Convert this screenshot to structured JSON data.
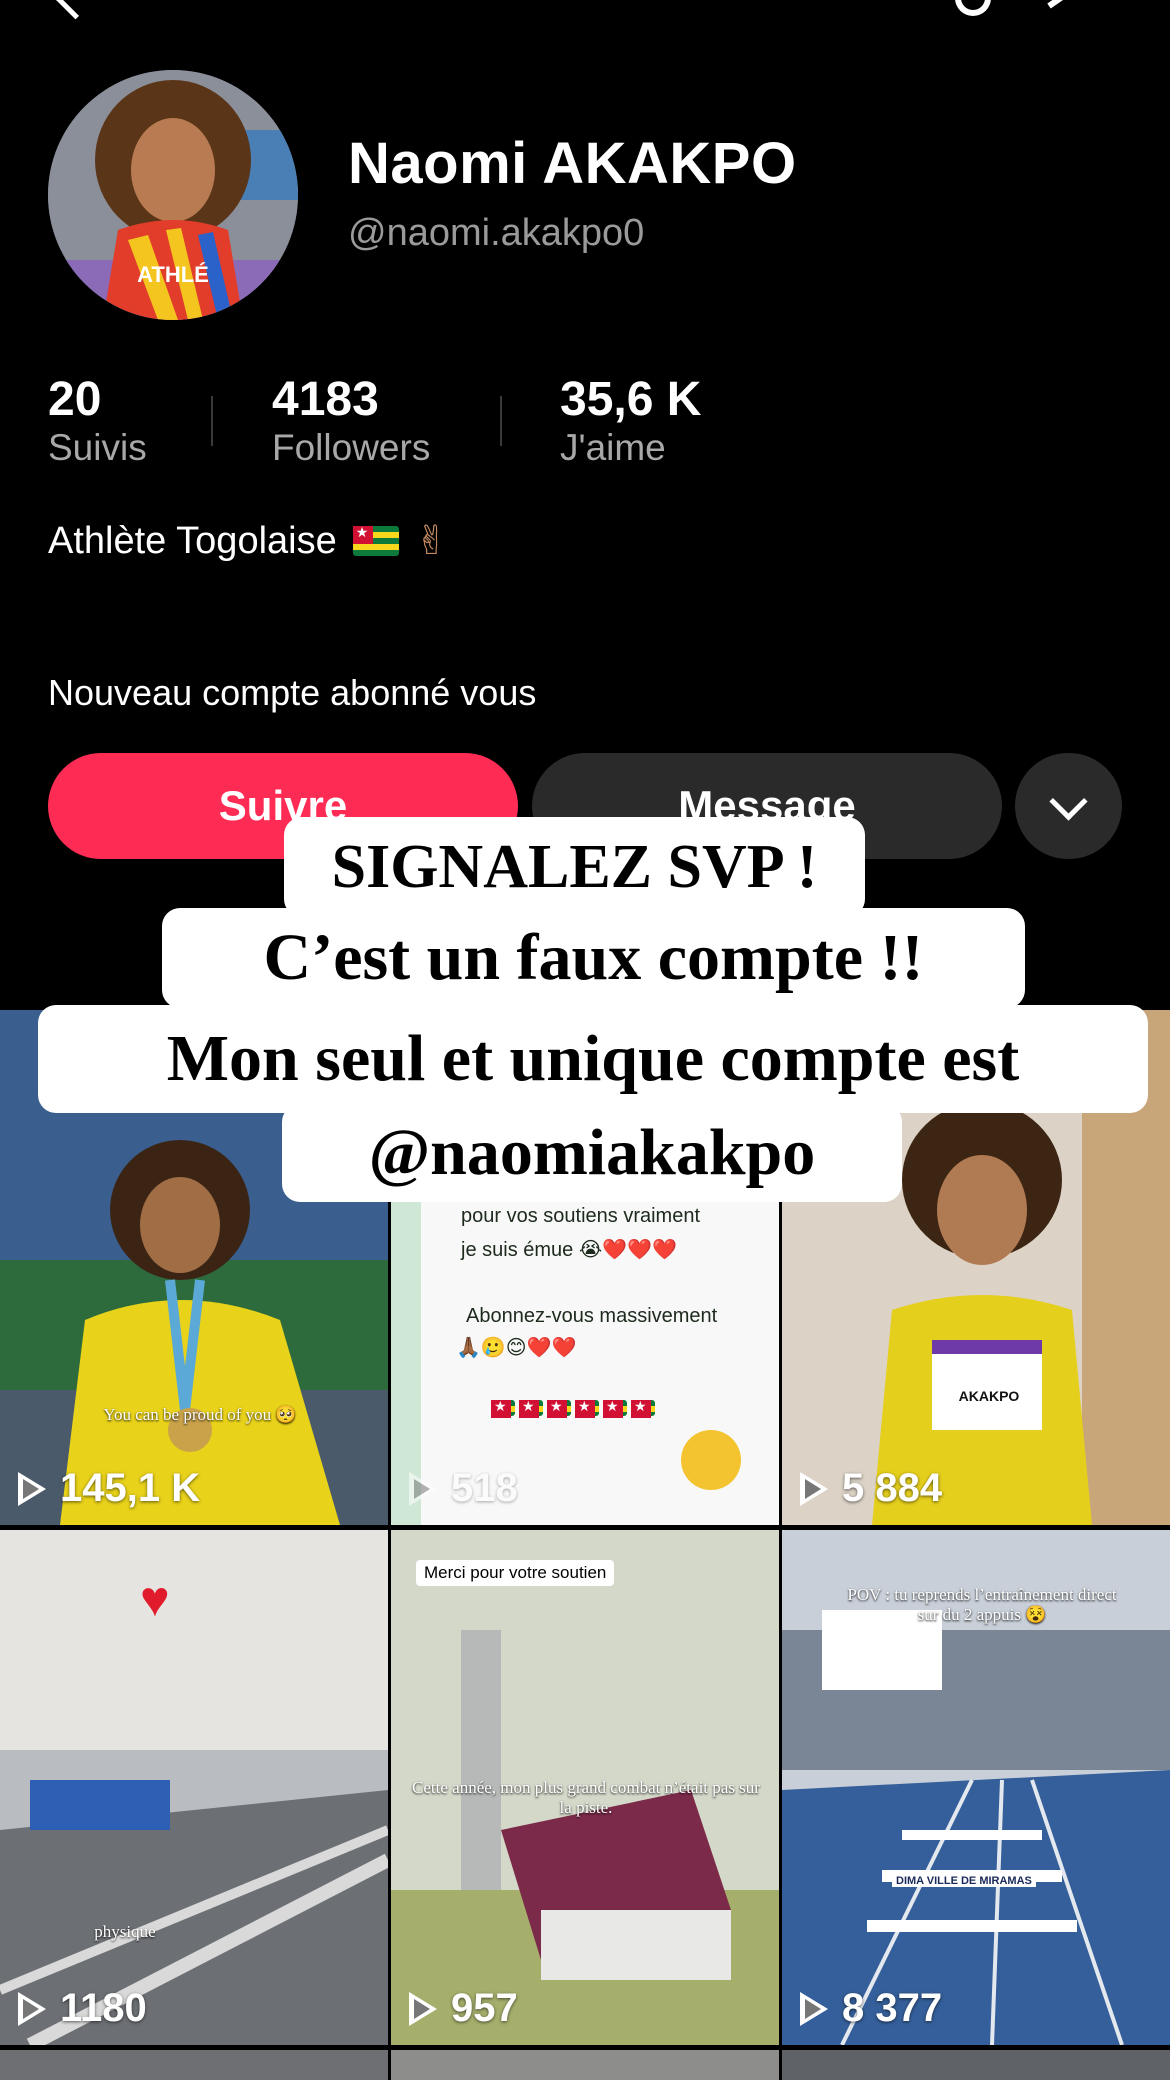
{
  "profile": {
    "name": "Naomi AKAKPO",
    "handle": "@naomi.akakpo0",
    "bio": "Athlète Togolaise",
    "notice": "Nouveau compte abonné vous"
  },
  "stats": [
    {
      "value": "20",
      "label": "Suivis"
    },
    {
      "value": "4183",
      "label": "Followers"
    },
    {
      "value": "35,6 K",
      "label": "J'aime"
    }
  ],
  "buttons": {
    "follow": "Suivre",
    "message": "Message"
  },
  "overlay": {
    "line1": "SIGNALEZ SVP !",
    "line2": "C’est un faux compte !!",
    "line3": "Mon seul et unique compte est",
    "line4": "@naomiakakpo"
  },
  "videos": [
    {
      "views": "145,1 K",
      "caption": "You can be proud of you 🥺"
    },
    {
      "views": "518",
      "caption_l1": "pour vos soutiens vraiment",
      "caption_l2": "je suis émue 😭❤️❤️❤️",
      "caption_l3": "Abonnez-vous massivement",
      "caption_l4": "🙏🏾🥲😊❤️❤️"
    },
    {
      "views": "5 884",
      "bib": "AKAKPO"
    },
    {
      "views": "1180",
      "caption": "physique"
    },
    {
      "views": "957",
      "caption_top": "Merci pour votre soutien",
      "caption": "Cette année, mon plus grand combat n’était pas sur la piste."
    },
    {
      "views": "8 377",
      "caption_top": "POV : tu reprends l’entraînement direct sur du 2 appuis 😵",
      "banner": "DIMA VILLE DE MIRAMAS"
    }
  ],
  "colors": {
    "accent": "#fe2c55",
    "secondary_button": "#2a2a2a",
    "background": "#000000"
  }
}
